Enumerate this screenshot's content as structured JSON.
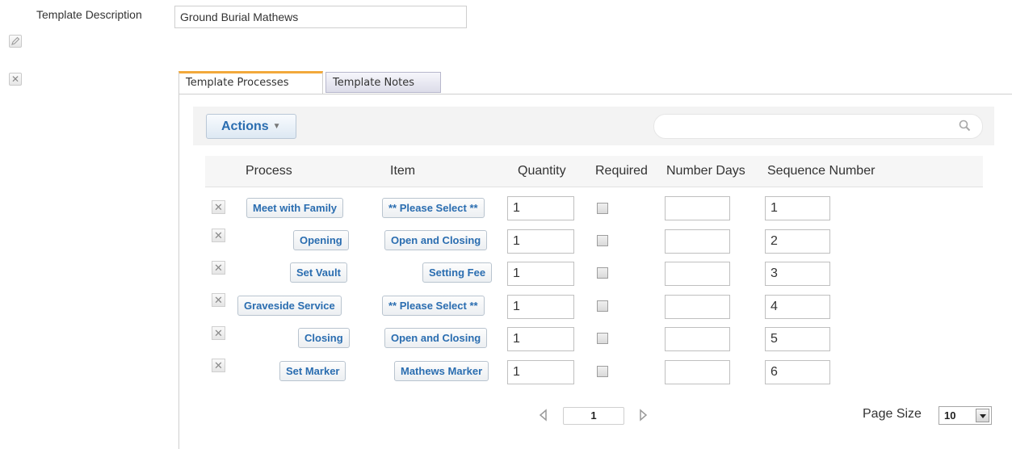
{
  "form": {
    "description_label": "Template Description",
    "description_value": "Ground Burial Mathews"
  },
  "tabs": [
    {
      "label": "Template Processes",
      "active": true
    },
    {
      "label": "Template Notes",
      "active": false
    }
  ],
  "toolbar": {
    "actions_label": "Actions",
    "search_value": ""
  },
  "table": {
    "columns": [
      "Process",
      "Item",
      "Quantity",
      "Required",
      "Number Days",
      "Sequence Number"
    ],
    "rows": [
      {
        "process": "Meet with Family",
        "item": "** Please Select **",
        "quantity": "1",
        "required": false,
        "number_days": "",
        "sequence": "1"
      },
      {
        "process": "Opening",
        "item": "Open and Closing",
        "quantity": "1",
        "required": false,
        "number_days": "",
        "sequence": "2"
      },
      {
        "process": "Set Vault",
        "item": "Setting Fee",
        "quantity": "1",
        "required": false,
        "number_days": "",
        "sequence": "3"
      },
      {
        "process": "Graveside Service",
        "item": "** Please Select **",
        "quantity": "1",
        "required": false,
        "number_days": "",
        "sequence": "4"
      },
      {
        "process": "Closing",
        "item": "Open and Closing",
        "quantity": "1",
        "required": false,
        "number_days": "",
        "sequence": "5"
      },
      {
        "process": "Set Marker",
        "item": "Mathews Marker",
        "quantity": "1",
        "required": false,
        "number_days": "",
        "sequence": "6"
      }
    ]
  },
  "pager": {
    "page": "1",
    "page_size_label": "Page Size",
    "page_size": "10"
  },
  "icons": {
    "edit": "pencil-icon",
    "delete": "close-icon",
    "search": "search-icon",
    "prev": "triangle-left-icon",
    "next": "triangle-right-icon"
  },
  "colors": {
    "link_blue": "#2a6db0",
    "active_tab_accent": "#f2a93b",
    "inactive_tab_bg": "#dcdce9"
  }
}
